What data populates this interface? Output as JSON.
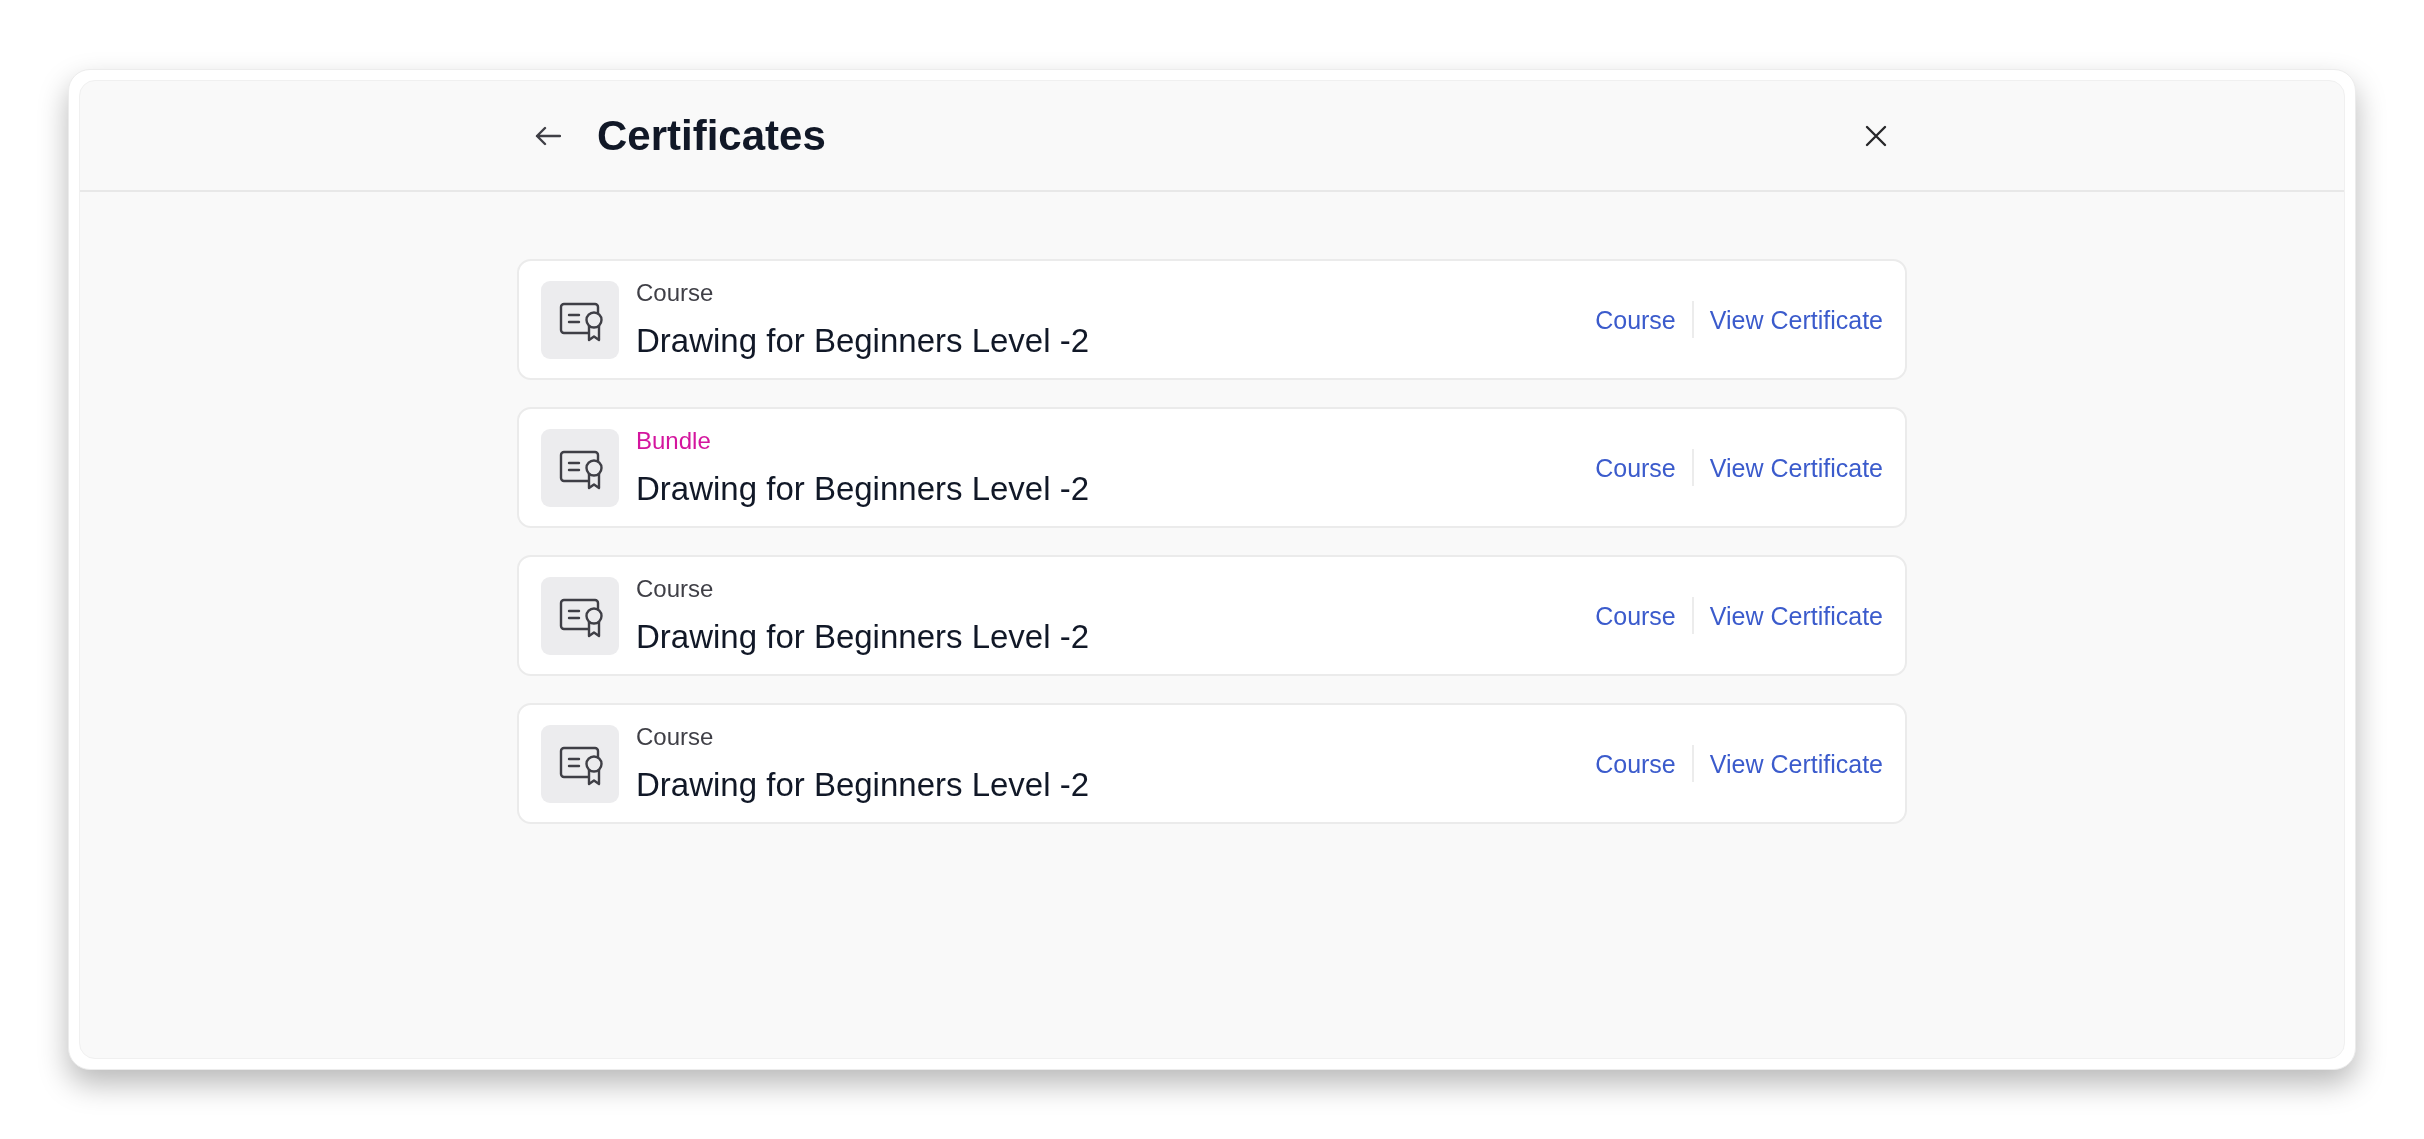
{
  "header": {
    "title": "Certificates"
  },
  "certificates": [
    {
      "kind": "course",
      "type_label": "Course",
      "title": "Drawing for Beginners Level -2",
      "links": [
        "Course",
        "View Certificate"
      ]
    },
    {
      "kind": "bundle",
      "type_label": "Bundle",
      "title": "Drawing for Beginners Level -2",
      "links": [
        "Course",
        "View Certificate"
      ]
    },
    {
      "kind": "course",
      "type_label": "Course",
      "title": "Drawing for Beginners Level -2",
      "links": [
        "Course",
        "View Certificate"
      ]
    },
    {
      "kind": "course",
      "type_label": "Course",
      "title": "Drawing for Beginners Level -2",
      "links": [
        "Course",
        "View Certificate"
      ]
    }
  ]
}
